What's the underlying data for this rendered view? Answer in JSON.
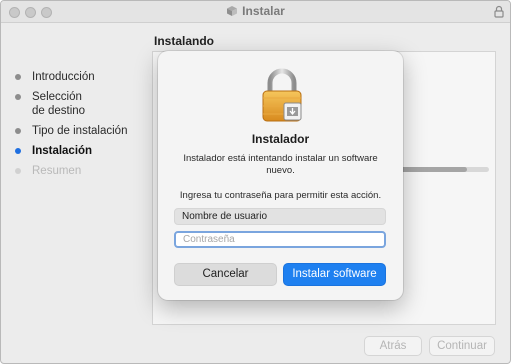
{
  "window": {
    "title": "Instalar",
    "section_title": "Instalando"
  },
  "steps": [
    {
      "label": "Introducción",
      "state": "done"
    },
    {
      "label": "Selección",
      "label_line2": "de destino",
      "state": "done"
    },
    {
      "label": "Tipo de instalación",
      "state": "done"
    },
    {
      "label": "Instalación",
      "state": "active"
    },
    {
      "label": "Resumen",
      "state": "future"
    }
  ],
  "progress": {
    "value": 0.75
  },
  "footer": {
    "back_label": "Atrás",
    "continue_label": "Continuar"
  },
  "dialog": {
    "title": "Instalador",
    "message": "Instalador está intentando instalar un software nuevo.",
    "prompt": "Ingresa tu contraseña para permitir esta acción.",
    "username_value": "Nombre de usuario",
    "password_placeholder": "Contraseña",
    "cancel_label": "Cancelar",
    "install_label": "Instalar software"
  },
  "colors": {
    "accent": "#1e80f0",
    "active_dot": "#1f6fe0",
    "focus_ring": "#7aa5de"
  },
  "icons": {
    "title_icon": "package-icon",
    "titlebar_lock": "lock-icon",
    "dialog_icon": "padlock-icon"
  }
}
